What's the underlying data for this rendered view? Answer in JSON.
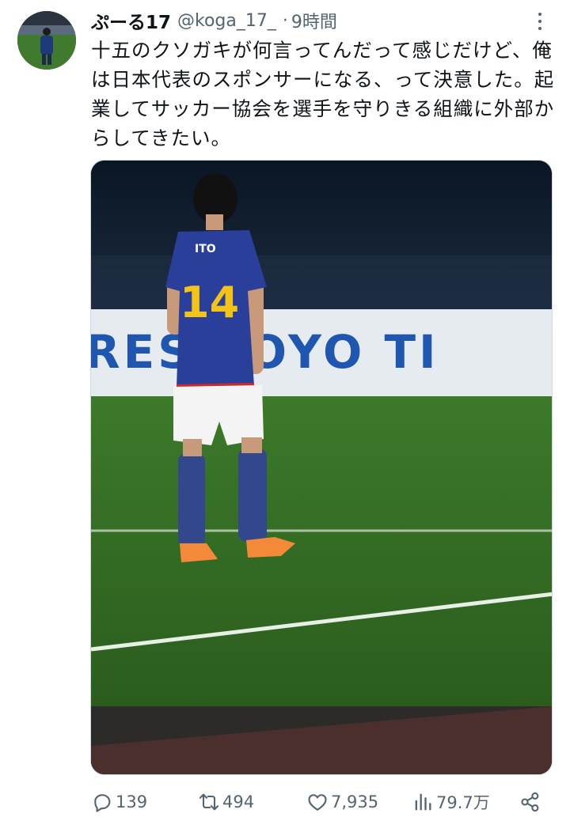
{
  "tweet": {
    "display_name": "ぷーる17",
    "handle": "@koga_17_",
    "separator": "·",
    "time": "9時間",
    "text": "十五のクソガキが何言ってんだって感じだけど、俺は日本代表のスポンサーになる、って決意した。起業してサッカー協会を選手を守りきる組織に外部からしてきたい。"
  },
  "media": {
    "jersey_name": "ITO",
    "jersey_number": "14",
    "board_text": "RES TOYO TI"
  },
  "actions": {
    "reply_count": "139",
    "retweet_count": "494",
    "like_count": "7,935",
    "views_count": "79.7万"
  },
  "colors": {
    "text": "#0f1419",
    "secondary": "#536471",
    "pitch": "#2f6b22",
    "jersey": "#2a3f9a",
    "board": "#e9eef2",
    "board_text": "#1f57b0"
  },
  "icons": {
    "more": "more-dots-icon",
    "reply": "reply-bubble-icon",
    "retweet": "retweet-arrows-icon",
    "like": "heart-icon",
    "views": "bar-chart-icon",
    "share": "share-nodes-icon"
  }
}
